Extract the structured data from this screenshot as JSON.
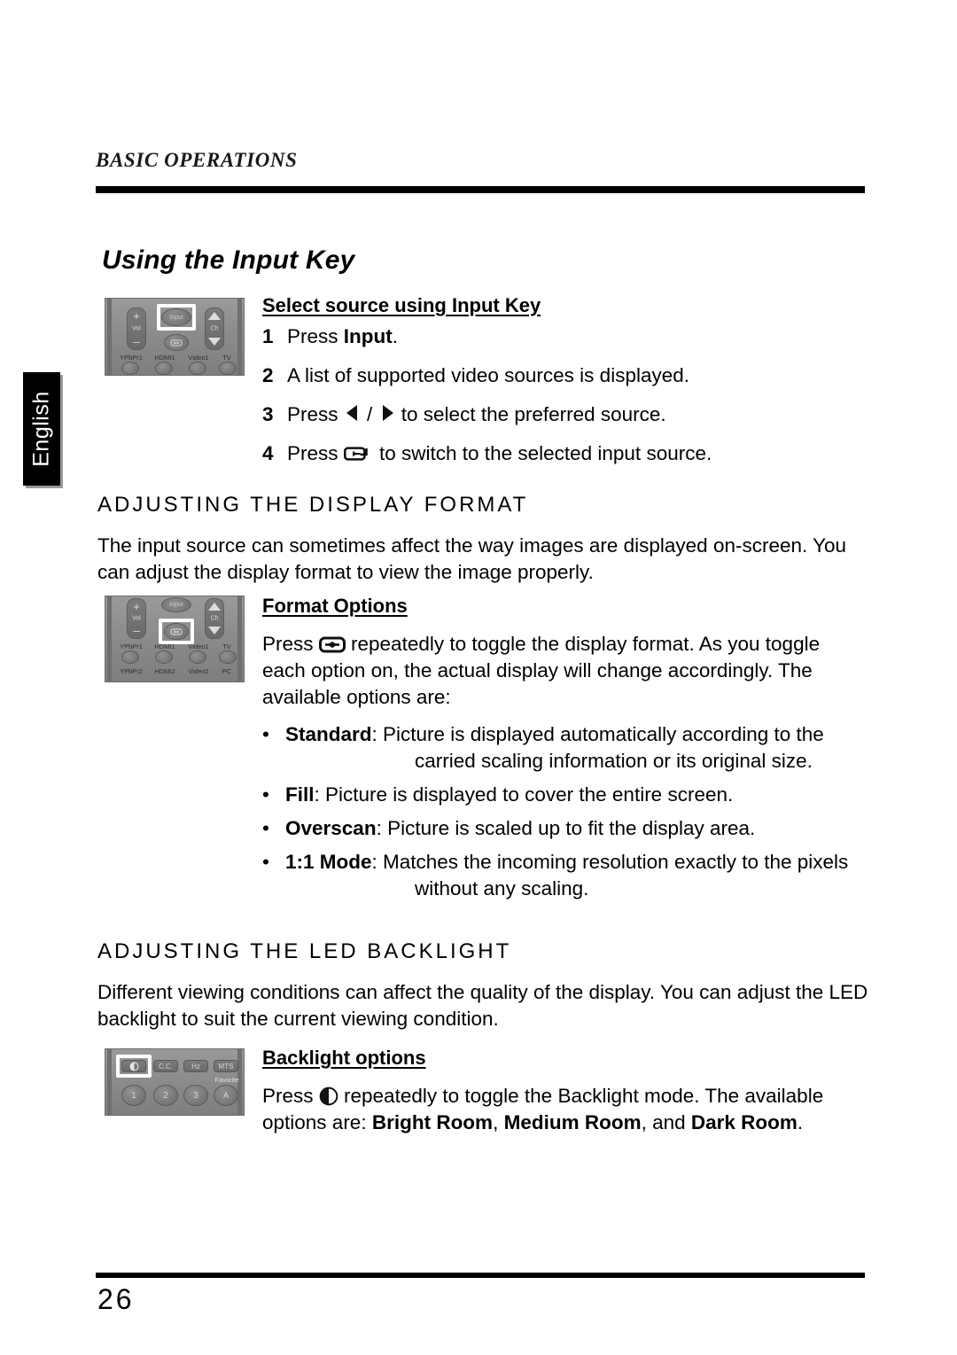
{
  "header": {
    "running_title": "BASIC OPERATIONS"
  },
  "side_tab": {
    "label": "English"
  },
  "page_title": "Using the Input Key",
  "input_key": {
    "sub_head": "Select source using Input Key",
    "steps": [
      {
        "num": "1",
        "pre": "Press ",
        "bold": "Input",
        "post": "."
      },
      {
        "num": "2",
        "pre": "A list of supported video sources is displayed.",
        "bold": "",
        "post": ""
      },
      {
        "num": "3",
        "pre": "Press ",
        "bold": "",
        "post": " to select the preferred source.",
        "icons": "left-right-arrows"
      },
      {
        "num": "4",
        "pre": "Press ",
        "bold": "",
        "post": " to switch to the selected input source.",
        "icons": "enter-key"
      }
    ]
  },
  "display_format": {
    "section_head": "ADJUSTING THE DISPLAY FORMAT",
    "paragraph": "The input source can sometimes affect the way images are displayed on-screen. You can adjust the display format to view the image properly.",
    "sub_head": "Format Options",
    "intro_pre": "Press ",
    "intro_post": " repeatedly to toggle the display format. As you toggle each option on, the actual display will change accordingly. The available options are:",
    "options": [
      {
        "term": "Standard",
        "desc": ": Picture is displayed automatically according to the carried scaling information or its original size.",
        "hanging": true
      },
      {
        "term": "Fill",
        "desc": ": Picture is displayed to cover the entire screen.",
        "hanging": false
      },
      {
        "term": "Overscan",
        "desc": ": Picture is scaled up to fit the display area.",
        "hanging": false
      },
      {
        "term": "1:1 Mode",
        "desc": ": Matches the incoming resolution exactly to the pixels without any scaling.",
        "hanging": true
      }
    ],
    "bullet_char": "•"
  },
  "led_backlight": {
    "section_head": "ADJUSTING THE LED BACKLIGHT",
    "paragraph": "Different viewing conditions can affect the quality of the display. You can adjust the LED backlight to suit the current viewing condition.",
    "sub_head": "Backlight options",
    "intro_pre": "Press ",
    "intro_mid": " repeatedly to toggle the Backlight mode. The available options are: ",
    "mode_1": "Bright Room",
    "sep_1": ", ",
    "mode_2": "Medium Room",
    "sep_2": ", and ",
    "mode_3": "Dark Room",
    "end": "."
  },
  "remote_input": {
    "vol_label": "Vol",
    "plus": "+",
    "minus": "–",
    "ch_label": "Ch",
    "input_key_label": "Input",
    "source_labels_top": [
      "YPbPr1",
      "HDMI1",
      "Video1",
      "TV"
    ]
  },
  "remote_format": {
    "vol_label": "Vol",
    "plus": "+",
    "minus": "–",
    "ch_label": "Ch",
    "input_key_label": "Input",
    "source_labels_top": [
      "YPbPr1",
      "HDMI1",
      "Video1",
      "TV"
    ],
    "source_labels_bottom": [
      "YPbPr2",
      "HDMI2",
      "Video2",
      "PC"
    ]
  },
  "remote_backlight": {
    "function_keys": [
      "C.C.",
      "Hz",
      "MTS"
    ],
    "favorite_label": "Favorite",
    "number_keys": [
      "1",
      "2",
      "3"
    ],
    "favorite_key": "A"
  },
  "footer": {
    "page_number": "26"
  },
  "colors": {
    "ink": "#000000",
    "paper": "#ffffff",
    "remote_body": "#8c8c8c",
    "remote_key": "#6e6e6e",
    "highlight": "#ffffff",
    "tab_bg": "#000000",
    "tab_text": "#ffffff"
  }
}
